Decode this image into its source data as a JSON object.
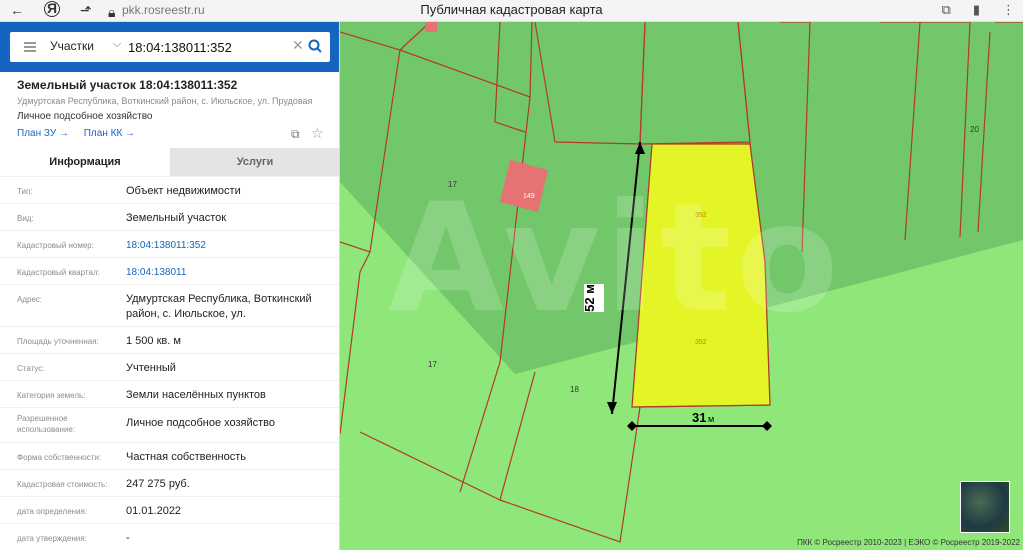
{
  "browser": {
    "url": "pkk.rosreestr.ru",
    "title": "Публичная кадастровая карта",
    "icons": [
      "back-icon",
      "yandex-icon",
      "share-icon",
      "lock-icon",
      "translate-icon",
      "bookmark-icon",
      "menu-icon"
    ]
  },
  "search": {
    "category": "Участки",
    "query": "18:04:138011:352"
  },
  "parcel": {
    "title": "Земельный участок 18:04:138011:352",
    "address": "Удмуртская Республика, Воткинский район, с. Июльское, ул. Прудовая",
    "use": "Личное подсобное хозяйство",
    "plan_zu": "План ЗУ →",
    "plan_kk": "План КК →"
  },
  "tabs": {
    "info": "Информация",
    "services": "Услуги"
  },
  "info": [
    {
      "label": "Тип:",
      "value": "Объект недвижимости"
    },
    {
      "label": "Вид:",
      "value": "Земельный участок"
    },
    {
      "label": "Кадастровый номер:",
      "value": "18:04:138011:352"
    },
    {
      "label": "Кадастровый квартал:",
      "value": "18:04:138011"
    },
    {
      "label": "Адрес:",
      "value": "Удмуртская Республика, Воткинский район, с. Июльское, ул."
    },
    {
      "label": "Площадь уточненная:",
      "value": "1 500 кв. м"
    },
    {
      "label": "Статус:",
      "value": "Учтенный"
    },
    {
      "label": "Категория земель:",
      "value": "Земли населённых пунктов"
    },
    {
      "label": "Разрешенное использование:",
      "value": "Личное подсобное хозяйство"
    },
    {
      "label": "Форма собственности:",
      "value": "Частная собственность"
    },
    {
      "label": "Кадастровая стоимость:",
      "value": "247 275 руб."
    },
    {
      "label": "дата определения:",
      "value": "01.01.2022"
    },
    {
      "label": "дата утверждения:",
      "value": "-"
    }
  ],
  "map": {
    "labels": {
      "p17a": "17",
      "p17b": "17",
      "p18": "18",
      "p20": "20",
      "p352a": "352",
      "p352b": "352",
      "p149": "149"
    },
    "measure_vertical": "52 м",
    "measure_horizontal_num": "31",
    "measure_horizontal_unit": "м",
    "watermark": "Avito",
    "copyright": "ПКК © Росреестр 2010-2023 | ЕЭКО © Росреестр 2019-2022",
    "colors": {
      "bg": "#8fe77a",
      "parcel": "#72c76a",
      "highlight": "#e3f527",
      "building": "#e57373",
      "border": "#b23a2a"
    }
  }
}
